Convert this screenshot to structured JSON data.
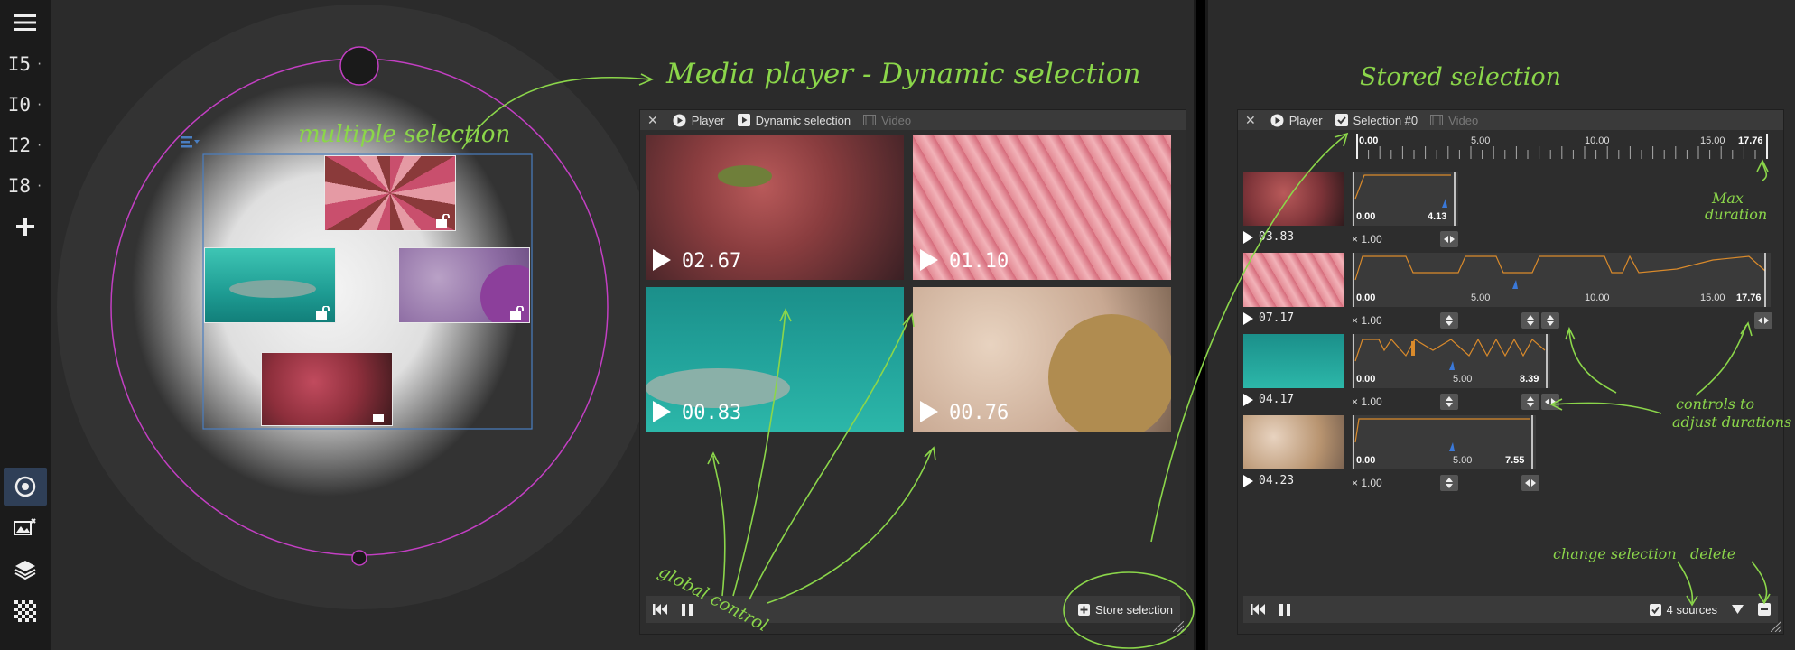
{
  "sidebar": {
    "items": [
      {
        "label": "I5",
        "bullet": "·"
      },
      {
        "label": "I0",
        "bullet": "·"
      },
      {
        "label": "I2",
        "bullet": "·"
      },
      {
        "label": "I8",
        "bullet": "·"
      }
    ]
  },
  "player": {
    "tabs": {
      "player": "Player",
      "dynamic": "Dynamic selection",
      "video": "Video"
    },
    "clips": [
      {
        "label": "02.67"
      },
      {
        "label": "01.10"
      },
      {
        "label": "00.83"
      },
      {
        "label": "00.76"
      }
    ],
    "store_label": "Store selection"
  },
  "stored": {
    "tabs": {
      "player": "Player",
      "selection": "Selection #0",
      "video": "Video"
    },
    "timeline": {
      "start": "0.00",
      "t5": "5.00",
      "t10": "10.00",
      "t15": "15.00",
      "max": "17.76"
    },
    "rows": [
      {
        "time": "03.83",
        "speed": "× 1.00",
        "start": "0.00",
        "end": "4.13"
      },
      {
        "time": "07.17",
        "speed": "× 1.00",
        "start": "0.00",
        "t5": "5.00",
        "t10": "10.00",
        "t15": "15.00",
        "end": "17.76"
      },
      {
        "time": "04.17",
        "speed": "× 1.00",
        "start": "0.00",
        "t5": "5.00",
        "end": "8.39"
      },
      {
        "time": "04.23",
        "speed": "× 1.00",
        "start": "0.00",
        "t5": "5.00",
        "end": "7.55"
      }
    ],
    "sources_label": "4 sources"
  },
  "annotations": {
    "title_player": "Media player - Dynamic selection",
    "title_stored": "Stored selection",
    "multi": "multiple selection",
    "global": "global control",
    "max_duration_1": "Max",
    "max_duration_2": "duration",
    "controls_1": "controls to",
    "controls_2": "adjust durations",
    "change": "change selection",
    "delete": "delete"
  },
  "colors": {
    "accent": "#8bd64a",
    "ring": "#c33fc3",
    "selection": "#4a7ec0",
    "curve": "#d98a2b",
    "marker": "#3a78d8"
  }
}
